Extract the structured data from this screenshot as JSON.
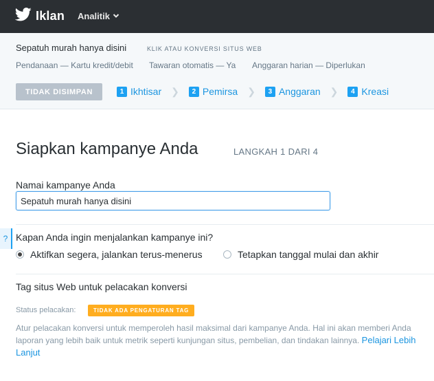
{
  "header": {
    "brand_title": "Iklan",
    "nav_analytics": "Analitik"
  },
  "summary": {
    "campaign_name": "Sepatuh murah hanya disini",
    "objective": "KLIK ATAU KONVERSI SITUS WEB",
    "funding": "Pendanaan — Kartu kredit/debit",
    "bid": "Tawaran otomatis — Ya",
    "budget": "Anggaran harian — Diperlukan",
    "unsaved_button": "TIDAK DISIMPAN",
    "steps": [
      {
        "num": "1",
        "label": "Ikhtisar"
      },
      {
        "num": "2",
        "label": "Pemirsa"
      },
      {
        "num": "3",
        "label": "Anggaran"
      },
      {
        "num": "4",
        "label": "Kreasi"
      }
    ]
  },
  "main": {
    "title": "Siapkan kampanye Anda",
    "step_indicator": "LANGKAH 1 DARI 4",
    "name_label": "Namai kampanye Anda",
    "name_value": "Sepatuh murah hanya disini",
    "help_icon": "?",
    "question": "Kapan Anda ingin menjalankan kampanye ini?",
    "option_start_now": "Aktifkan segera, jalankan terus-menerus",
    "option_set_dates": "Tetapkan tanggal mulai dan akhir",
    "selected_option": "start_now",
    "tag_heading": "Tag situs Web untuk pelacakan konversi",
    "status_label": "Status pelacakan:",
    "status_badge": "TIDAK ADA PENGATURAN TAG",
    "description": "Atur pelacakan konversi untuk memperoleh hasil maksimal dari kampanye Anda. Hal ini akan memberi Anda laporan yang lebih baik untuk metrik seperti kunjungan situs, pembelian, dan tindakan lainnya.",
    "learn_more": "Pelajari Lebih Lanjut"
  },
  "colors": {
    "topbar": "#2b2f33",
    "accent": "#1da1f2",
    "badge": "#ffad1f"
  }
}
